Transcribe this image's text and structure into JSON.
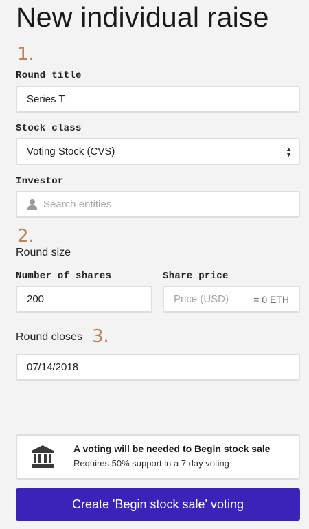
{
  "page": {
    "title": "New individual raise"
  },
  "steps": {
    "one": "1.",
    "two": "2.",
    "three": "3."
  },
  "round_title": {
    "label": "Round title",
    "value": "Series T"
  },
  "stock_class": {
    "label": "Stock class",
    "selected": "Voting Stock (CVS)"
  },
  "investor": {
    "label": "Investor",
    "placeholder": "Search entities",
    "icon": "person-icon"
  },
  "round_size": {
    "label": "Round size",
    "shares_label": "Number of shares",
    "shares_value": "200",
    "price_label": "Share price",
    "price_placeholder": "Price (USD)",
    "price_eth": "= 0 ETH"
  },
  "round_closes": {
    "label": "Round closes",
    "value": "07/14/2018"
  },
  "notice": {
    "icon": "bank-icon",
    "title": "A voting will be needed to Begin stock sale",
    "subtitle": "Requires 50% support in a 7 day voting"
  },
  "cta": {
    "label": "Create 'Begin stock sale' voting",
    "color": "#3b22b8"
  },
  "colors": {
    "step_accent": "#b9825a",
    "background": "#f3f3f3"
  }
}
